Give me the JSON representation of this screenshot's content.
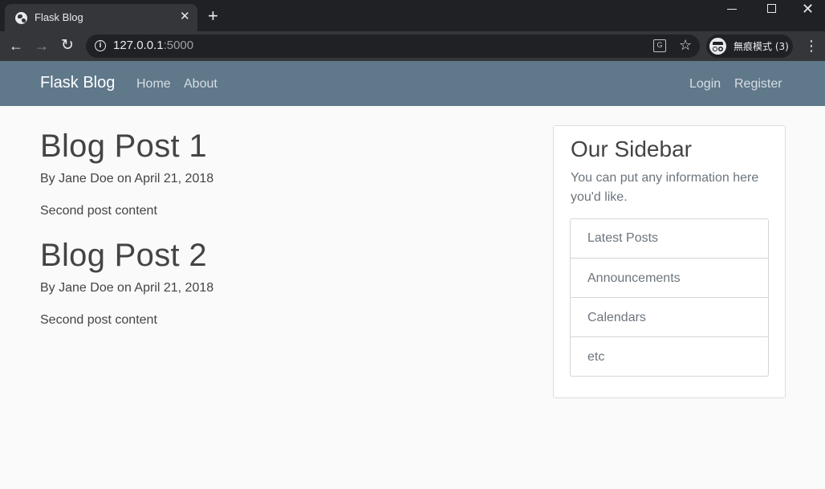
{
  "browser": {
    "tab_title": "Flask Blog",
    "url_host": "127.0.0.1",
    "url_port": ":5000",
    "incognito_label": "無痕模式 (3)"
  },
  "site": {
    "brand": "Flask Blog",
    "nav_left": [
      "Home",
      "About"
    ],
    "nav_right": [
      "Login",
      "Register"
    ]
  },
  "posts": [
    {
      "title": "Blog Post 1",
      "meta": "By Jane Doe on April 21, 2018",
      "content": "Second post content"
    },
    {
      "title": "Blog Post 2",
      "meta": "By Jane Doe on April 21, 2018",
      "content": "Second post content"
    }
  ],
  "sidebar": {
    "title": "Our Sidebar",
    "text": "You can put any information here you'd like.",
    "items": [
      "Latest Posts",
      "Announcements",
      "Calendars",
      "etc"
    ]
  },
  "colors": {
    "navbar": "#5f788a",
    "page_bg": "#fafafa",
    "text": "#444444",
    "muted": "#6c757d"
  },
  "icons": [
    "globe-icon",
    "close-icon",
    "plus-icon",
    "back-arrow-icon",
    "forward-arrow-icon",
    "reload-icon",
    "info-icon",
    "translate-icon",
    "star-icon",
    "incognito-icon",
    "menu-dots-icon"
  ]
}
